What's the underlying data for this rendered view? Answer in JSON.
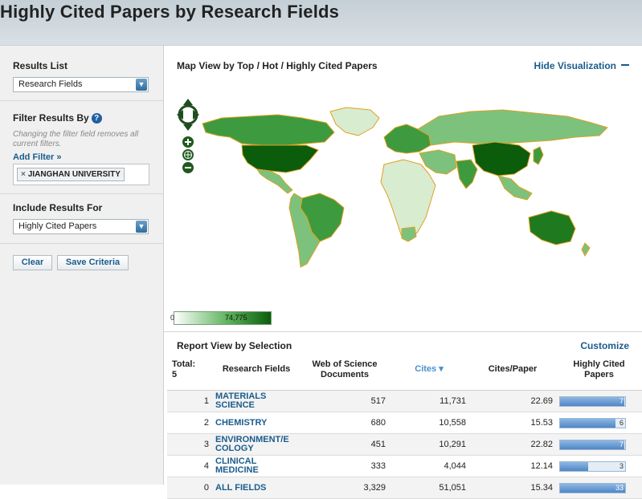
{
  "page": {
    "title": "Highly Cited Papers by Research Fields"
  },
  "sidebar": {
    "results_list": {
      "title": "Results List",
      "selected": "Research Fields"
    },
    "filter": {
      "title": "Filter Results By",
      "note": "Changing the filter field removes all current filters.",
      "add_filter": "Add Filter »",
      "chip_remove": "×",
      "chip": "JIANGHAN UNIVERSITY"
    },
    "include": {
      "title": "Include Results For",
      "selected": "Highly Cited Papers"
    },
    "buttons": {
      "clear": "Clear",
      "save": "Save Criteria"
    }
  },
  "visualization": {
    "title": "Map View by Top / Hot / Highly Cited Papers",
    "hide": "Hide Visualization",
    "legend_min": "0",
    "legend_max": "74,775",
    "colors": {
      "dark": "#0b5c0b",
      "mid": "#3e9a3e",
      "light": "#7cc27c",
      "pale": "#d8ecd0",
      "border": "#e0a020",
      "ocean": "#ffffff"
    }
  },
  "report": {
    "title": "Report View by Selection",
    "customize": "Customize",
    "headers": {
      "total_label": "Total:",
      "total_value": "5",
      "field": "Research Fields",
      "docs": "Web of Science Documents",
      "cites": "Cites ▾",
      "cpp": "Cites/Paper",
      "hcp": "Highly Cited Papers"
    },
    "rows": [
      {
        "rank": "1",
        "field": "MATERIALS SCIENCE",
        "docs": "517",
        "cites": "11,731",
        "cpp": "22.69",
        "hcp": "7",
        "fill": 0.99
      },
      {
        "rank": "2",
        "field": "CHEMISTRY",
        "docs": "680",
        "cites": "10,558",
        "cpp": "15.53",
        "hcp": "6",
        "fill": 0.85
      },
      {
        "rank": "3",
        "field": "ENVIRONMENT/E COLOGY",
        "docs": "451",
        "cites": "10,291",
        "cpp": "22.82",
        "hcp": "7",
        "fill": 0.99
      },
      {
        "rank": "4",
        "field": "CLINICAL MEDICINE",
        "docs": "333",
        "cites": "4,044",
        "cpp": "12.14",
        "hcp": "3",
        "fill": 0.43
      },
      {
        "rank": "0",
        "field": "ALL FIELDS",
        "docs": "3,329",
        "cites": "51,051",
        "cpp": "15.34",
        "hcp": "33",
        "fill": 1.0
      }
    ]
  }
}
